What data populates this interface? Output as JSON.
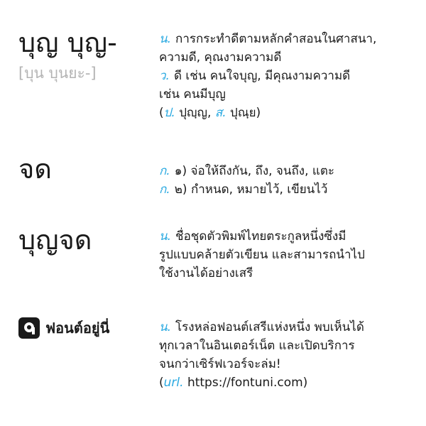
{
  "entries": [
    {
      "term": "บุญ บุญ-",
      "pronunciation": "[บุน บุนยะ-]",
      "lines": [
        {
          "pos": "น.",
          "text": "การกระทำดีตามหลักคำสอนในศาสนา,"
        },
        {
          "pos": "",
          "text": "ความดี, คุณงามความดี"
        },
        {
          "pos": "ว.",
          "text": "ดี เช่น คนใจบุญ, มีคุณงามความดี"
        },
        {
          "pos": "",
          "text": "เช่น คนมีบุญ"
        }
      ],
      "etymology": {
        "open": "(",
        "p_label": "ป.",
        "p_word": "ปุญฺญ,",
        "s_label": "ส.",
        "s_word": "ปุณฺย)"
      }
    },
    {
      "term": "จด",
      "lines": [
        {
          "pos": "ก.",
          "text": "๑) จ่อให้ถึงกัน, ถึง, จนถึง, แตะ"
        },
        {
          "pos": "ก.",
          "text": "๒) กำหนด, หมายไว้, เขียนไว้"
        }
      ]
    },
    {
      "term": "บุญจด",
      "lines": [
        {
          "pos": "น.",
          "text": "ชื่อชุดตัวพิมพ์ไทยตระกูลหนึ่งซึ่งมี"
        },
        {
          "pos": "",
          "text": "รูปแบบคล้ายตัวเขียน และสามารถนำไป"
        },
        {
          "pos": "",
          "text": "ใช้งานได้อย่างเสรี"
        }
      ]
    },
    {
      "brand": "ฟอนต์อยู่นี่",
      "logo_icon": "fontuni-logo",
      "lines": [
        {
          "pos": "น.",
          "text": "โรงหล่อฟอนต์เสรีแห่งหนึ่ง พบเห็นได้"
        },
        {
          "pos": "",
          "text": "ทุกเวลาในอินเตอร์เน็ต และเปิดบริการ"
        },
        {
          "pos": "",
          "text": "จนกว่าเซิร์ฟเวอร์จะล่ม!"
        }
      ],
      "url_line": {
        "open": "(",
        "label": "url.",
        "url": "https://fontuni.com)"
      }
    }
  ],
  "colors": {
    "accent": "#29a9e1",
    "text": "#1a1a1a",
    "muted": "#b3b3b3"
  }
}
